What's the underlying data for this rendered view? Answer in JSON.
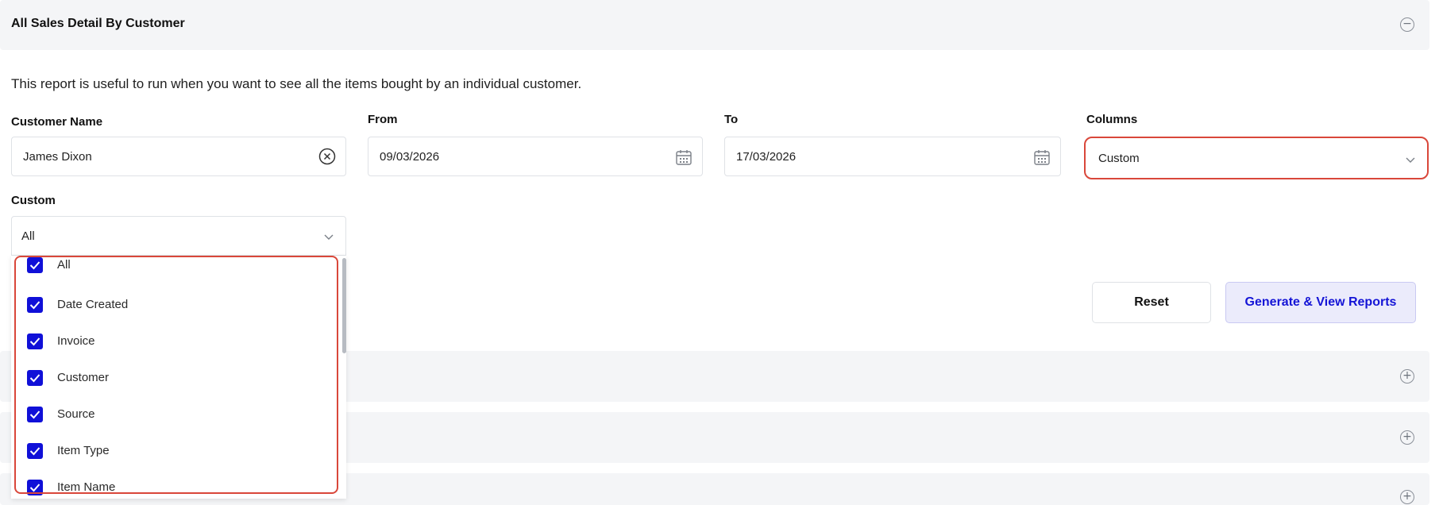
{
  "panel": {
    "title": "All Sales Detail By Customer",
    "description": "This report is useful to run when you want to see all the items bought by an individual customer."
  },
  "form": {
    "customer_name": {
      "label": "Customer Name",
      "value": "James Dixon"
    },
    "from": {
      "label": "From",
      "value": "09/03/2026"
    },
    "to": {
      "label": "To",
      "value": "17/03/2026"
    },
    "columns": {
      "label": "Columns",
      "value": "Custom"
    },
    "custom": {
      "label": "Custom",
      "value": "All"
    }
  },
  "custom_options": [
    {
      "label": "All",
      "checked": true
    },
    {
      "label": "Date Created",
      "checked": true
    },
    {
      "label": "Invoice",
      "checked": true
    },
    {
      "label": "Customer",
      "checked": true
    },
    {
      "label": "Source",
      "checked": true
    },
    {
      "label": "Item Type",
      "checked": true
    },
    {
      "label": "Item Name",
      "checked": true
    }
  ],
  "buttons": {
    "reset": "Reset",
    "generate": "Generate & View Reports"
  },
  "icons": {
    "collapse": "minus-circle-icon",
    "expand": "plus-circle-icon",
    "clear": "clear-x-icon",
    "calendar": "calendar-icon",
    "chevron": "chevron-down-icon",
    "check": "checkmark-icon"
  },
  "colors": {
    "accent": "#1010d8",
    "highlight_border": "#d9473a",
    "panel_bg": "#f4f5f7"
  }
}
